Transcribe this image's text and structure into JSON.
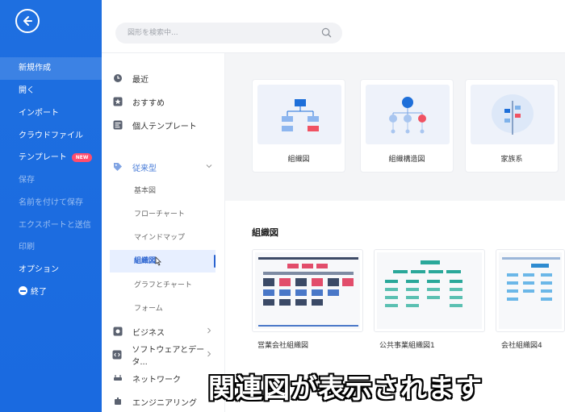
{
  "sidebar": {
    "items": [
      {
        "label": "新規作成",
        "state": "active"
      },
      {
        "label": "開く",
        "state": "normal"
      },
      {
        "label": "インポート",
        "state": "normal"
      },
      {
        "label": "クラウドファイル",
        "state": "normal"
      },
      {
        "label": "テンプレート",
        "state": "normal",
        "badge": "NEW"
      },
      {
        "label": "保存",
        "state": "dim"
      },
      {
        "label": "名前を付けて保存",
        "state": "dim"
      },
      {
        "label": "エクスポートと送信",
        "state": "dim"
      },
      {
        "label": "印刷",
        "state": "dim"
      },
      {
        "label": "オプション",
        "state": "normal"
      },
      {
        "label": "終了",
        "state": "normal"
      }
    ]
  },
  "search": {
    "placeholder": "図形を検索中..."
  },
  "categories": {
    "top": [
      {
        "label": "最近",
        "icon": "clock-icon"
      },
      {
        "label": "おすすめ",
        "icon": "star-icon"
      },
      {
        "label": "個人テンプレート",
        "icon": "template-icon"
      }
    ],
    "section": {
      "label": "従来型",
      "icon": "tag-icon"
    },
    "subs": [
      "基本図",
      "フローチャート",
      "マインドマップ",
      "組織図",
      "グラフとチャート",
      "フォーム"
    ],
    "selected_sub": "組織図",
    "bottom": [
      {
        "label": "ビジネス",
        "icon": "business-icon"
      },
      {
        "label": "ソフトウェアとデータ...",
        "icon": "code-icon"
      },
      {
        "label": "ネットワーク",
        "icon": "network-icon"
      },
      {
        "label": "エンジニアリング",
        "icon": "engineering-icon"
      }
    ]
  },
  "quick_cards": [
    {
      "label": "組織図"
    },
    {
      "label": "組織構造図"
    },
    {
      "label": "家族系"
    }
  ],
  "section_title": "組織図",
  "templates": [
    {
      "label": "営業会社組織図"
    },
    {
      "label": "公共事業組織図1"
    },
    {
      "label": "会社組織図4"
    }
  ],
  "overlay_caption": "関連図が表示されます",
  "colors": {
    "sidebar": "#1a6ae0",
    "accent": "#2a63d0",
    "selected_bg": "#e7efff"
  }
}
